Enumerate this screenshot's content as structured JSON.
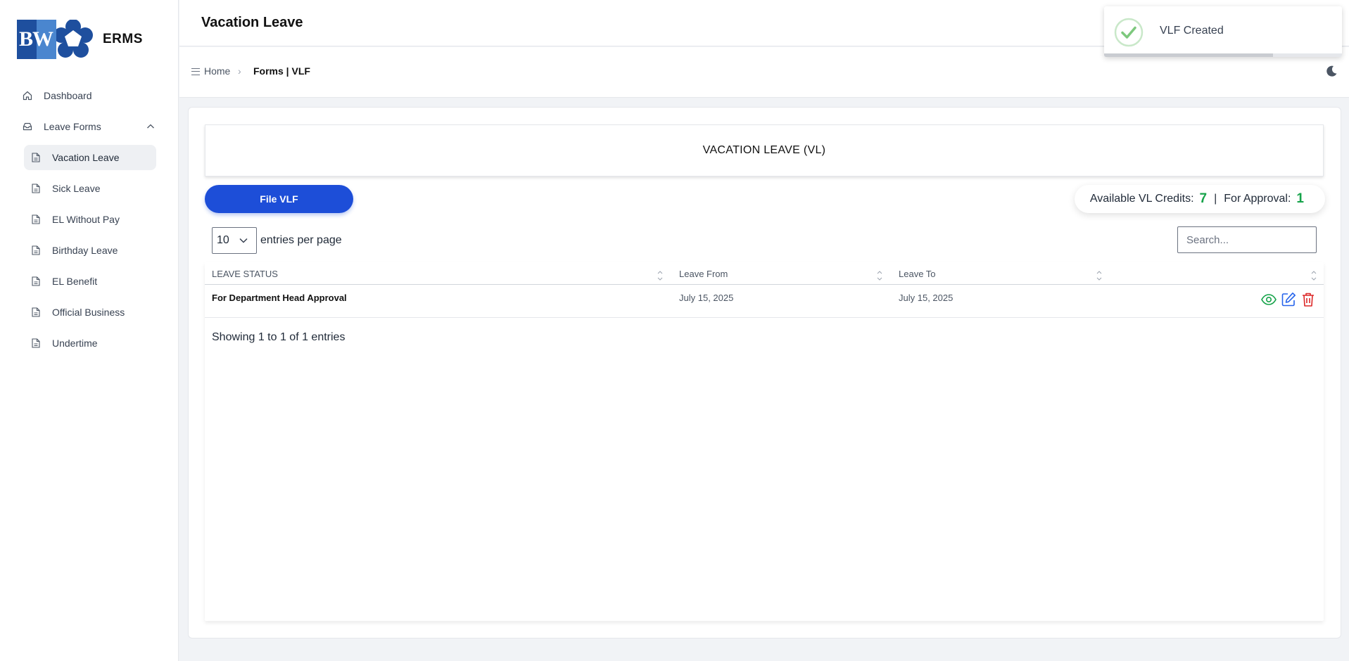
{
  "app": {
    "logo_text": "ERMS",
    "logo_monogram": "BW"
  },
  "sidebar": {
    "items": [
      {
        "label": "Dashboard",
        "icon": "home-icon"
      },
      {
        "label": "Leave Forms",
        "icon": "inbox-icon",
        "expanded": true
      }
    ],
    "sub_items": [
      {
        "label": "Vacation Leave",
        "active": true
      },
      {
        "label": "Sick Leave"
      },
      {
        "label": "EL Without Pay"
      },
      {
        "label": "Birthday Leave"
      },
      {
        "label": "EL Benefit"
      },
      {
        "label": "Official Business"
      },
      {
        "label": "Undertime"
      }
    ]
  },
  "header": {
    "title": "Vacation Leave"
  },
  "breadcrumb": {
    "home": "Home",
    "separator": "›",
    "current": "Forms | VLF"
  },
  "main": {
    "section_title": "VACATION LEAVE (VL)",
    "file_button": "File VLF",
    "credits": {
      "available_label": "Available VL Credits:",
      "available_value": "7",
      "separator": "|",
      "approval_label": "For Approval:",
      "approval_value": "1"
    },
    "table_controls": {
      "per_page_value": "10",
      "per_page_label": "entries per page",
      "search_placeholder": "Search..."
    },
    "table": {
      "headers": [
        "LEAVE STATUS",
        "Leave From",
        "Leave To",
        ""
      ],
      "rows": [
        {
          "status": "For Department Head Approval",
          "from": "July 15, 2025",
          "to": "July 15, 2025"
        }
      ]
    },
    "showing": "Showing 1 to 1 of 1 entries"
  },
  "toast": {
    "message": "VLF Created",
    "progress": 0.71
  },
  "colors": {
    "accent": "#1d4ed8",
    "success": "#16a34a",
    "danger": "#dc2626",
    "view_icon": "#16a34a",
    "edit_icon": "#2563eb"
  }
}
